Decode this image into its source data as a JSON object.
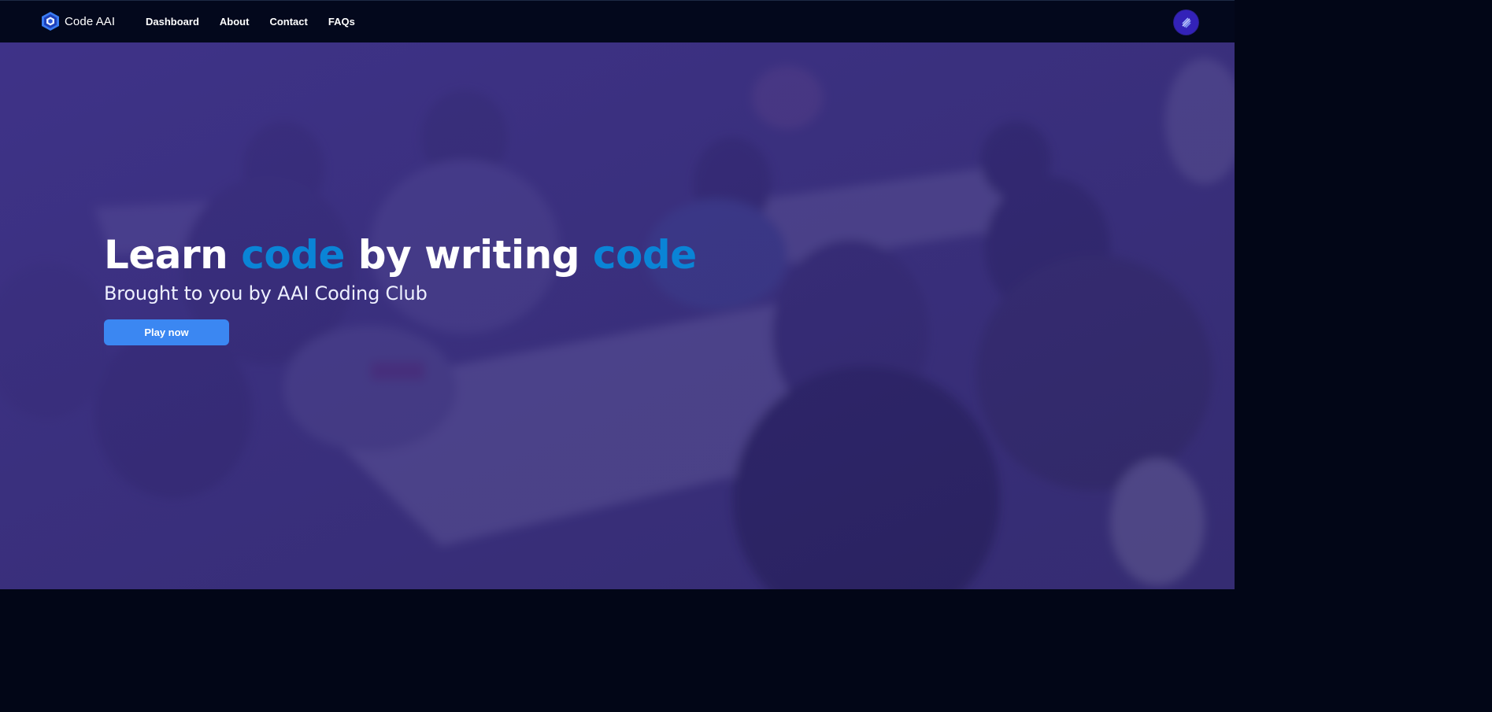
{
  "app": {
    "name": "Code AAI"
  },
  "nav": {
    "links": [
      {
        "label": "Dashboard"
      },
      {
        "label": "About"
      },
      {
        "label": "Contact"
      },
      {
        "label": "FAQs"
      }
    ]
  },
  "hero": {
    "headline": {
      "word1": "Learn ",
      "word2": "code",
      "word3": " by writing ",
      "word4": "code"
    },
    "subheadline": "Brought to you by AAI Coding Club",
    "cta_label": "Play now"
  },
  "colors": {
    "accent": "#0a84d6",
    "button": "#3b87f2",
    "navbar": "#03081c",
    "overlay": "#3a2d7c",
    "avatar": "#3322b8"
  },
  "icons": {
    "brand": "hexagon-logo-icon",
    "avatar": "user-avatar-icon"
  }
}
